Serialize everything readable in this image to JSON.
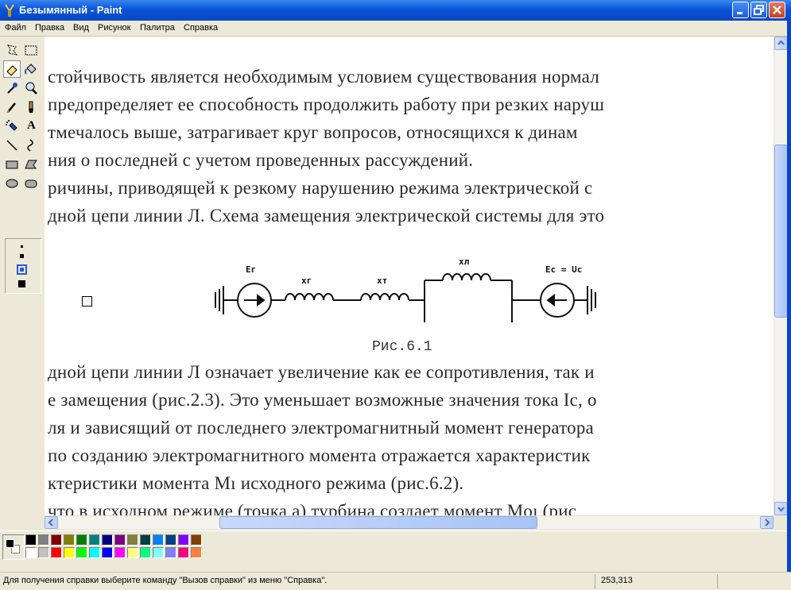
{
  "window": {
    "title": "Безымянный - Paint",
    "controls": [
      "minimize",
      "maximize",
      "close"
    ]
  },
  "menu": [
    "Файл",
    "Правка",
    "Вид",
    "Рисунок",
    "Палитра",
    "Справка"
  ],
  "tools": [
    {
      "icon": "free-select-icon"
    },
    {
      "icon": "rect-select-icon"
    },
    {
      "icon": "eraser-icon",
      "selected": true
    },
    {
      "icon": "fill-bucket-icon"
    },
    {
      "icon": "color-picker-icon"
    },
    {
      "icon": "magnifier-icon"
    },
    {
      "icon": "pencil-icon"
    },
    {
      "icon": "brush-icon"
    },
    {
      "icon": "airbrush-icon"
    },
    {
      "icon": "text-icon",
      "glyph": "A"
    },
    {
      "icon": "line-icon"
    },
    {
      "icon": "curve-icon"
    },
    {
      "icon": "rectangle-icon"
    },
    {
      "icon": "polygon-icon"
    },
    {
      "icon": "ellipse-icon"
    },
    {
      "icon": "rounded-rect-icon"
    }
  ],
  "canvas": {
    "text_lines": [
      "стойчивость является необходимым условием  существования нормал",
      " предопределяет ее способность продолжить работу при резких наруш",
      "тмечалось выше, затрагивает круг вопросов, относящихся к динам",
      "ния о последней с учетом проведенных рассуждений.",
      "ричины, приводящей к резкому нарушению режима электрической с",
      "дной цепи линии Л. Схема замещения электрической системы для это",
      "дной цепи линии Л означает увеличение как ее сопротивления, так и",
      "е замещения (рис.2.3). Это уменьшает возможные значения тока Iс, о",
      "ля и зависящий от последнего электромагнитный момент генератора",
      " по созданию электромагнитного момента отражается характеристик",
      "ктеристики момента Мı исходного режима (рис.6.2).",
      " что в исходном режиме (точка а) турбина создает момент Мoı (рис"
    ],
    "figure": {
      "labels": {
        "eg": "Eг",
        "x1": "xг",
        "x2": "xт",
        "xl": "xл",
        "ec": "Eс = Uс"
      },
      "caption": "Рис.6.1"
    }
  },
  "palette": {
    "foreground": "#000000",
    "background": "#ffffff",
    "top_row": [
      "#000000",
      "#808080",
      "#800000",
      "#808000",
      "#008000",
      "#008080",
      "#000080",
      "#800080",
      "#808040",
      "#004040",
      "#0080ff",
      "#004080",
      "#8000ff",
      "#804000"
    ],
    "bottom_row": [
      "#ffffff",
      "#c0c0c0",
      "#ff0000",
      "#ffff00",
      "#00ff00",
      "#00ffff",
      "#0000ff",
      "#ff00ff",
      "#ffff80",
      "#00ff80",
      "#80ffff",
      "#8080ff",
      "#ff0080",
      "#ff8040"
    ]
  },
  "status": {
    "help_text": "Для получения справки выберите команду \"Вызов справки\" из меню \"Справка\".",
    "coords": "253,313"
  },
  "colors": {
    "titlebar": "#0a55d8",
    "chrome": "#ece9d8"
  }
}
